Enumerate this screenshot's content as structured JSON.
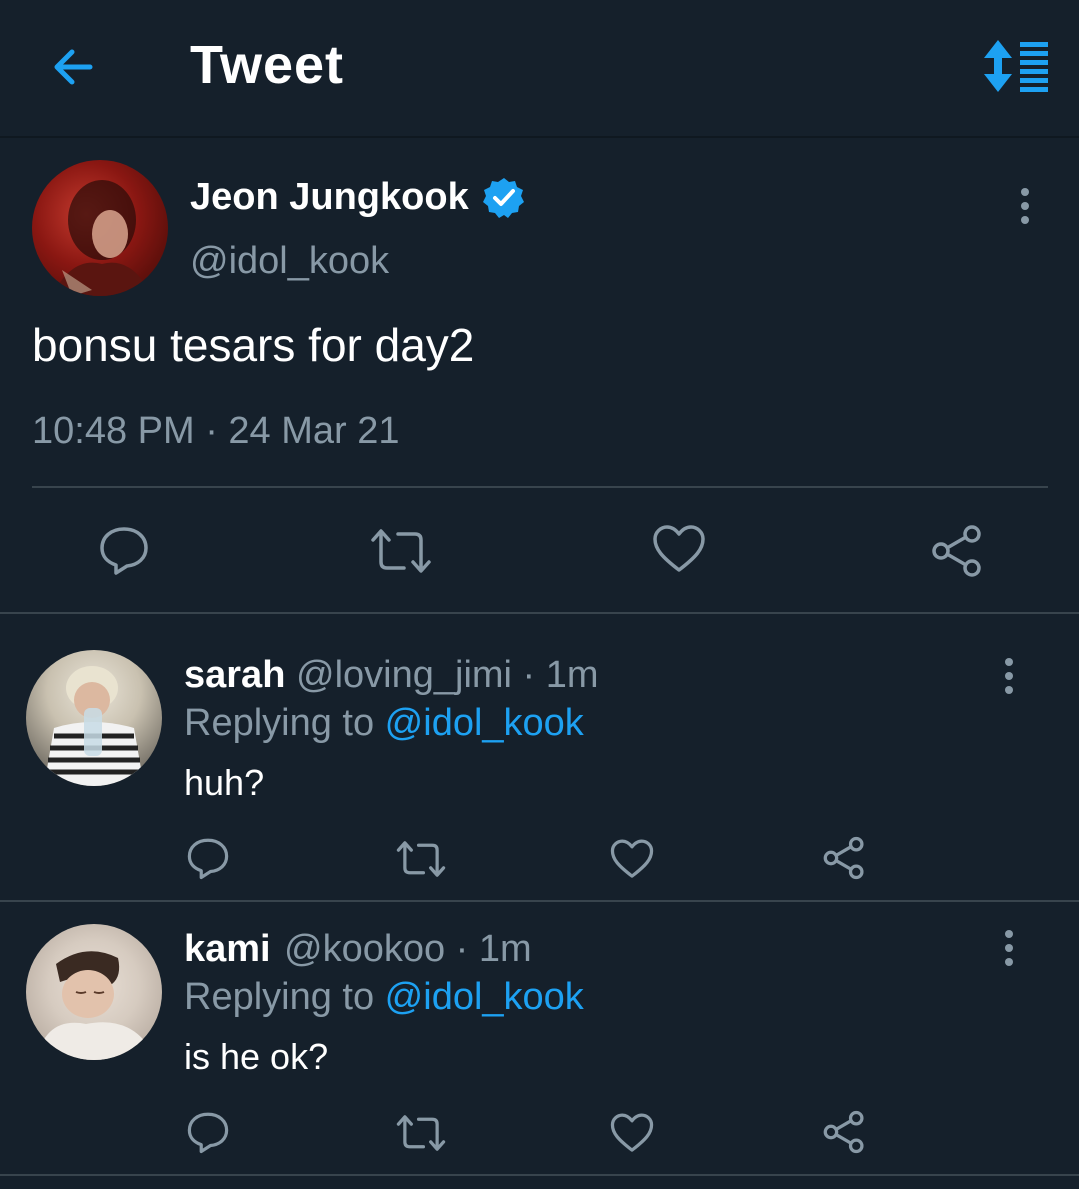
{
  "header": {
    "title": "Tweet",
    "back_icon": "arrow-left-icon",
    "sort_icon": "sort-replies-icon",
    "accent": "#1da1f2"
  },
  "tweet": {
    "name": "Jeon Jungkook",
    "handle": "@idol_kook",
    "verified": true,
    "text": "bonsu tesars for day2",
    "timestamp": "10:48 PM · 24 Mar 21"
  },
  "replies": [
    {
      "name": "sarah",
      "handle": "@loving_jimi",
      "time": " · 1m",
      "replying_label": "Replying to ",
      "replying_to": "@idol_kook",
      "text": "huh?"
    },
    {
      "name": "kami",
      "handle": "@kookoo",
      "time": " · 1m",
      "replying_label": "Replying to ",
      "replying_to": "@idol_kook",
      "text": "is he ok?"
    }
  ],
  "colors": {
    "background": "#15202b",
    "muted": "#8899a6",
    "divider": "#38444d",
    "accent": "#1da1f2"
  }
}
